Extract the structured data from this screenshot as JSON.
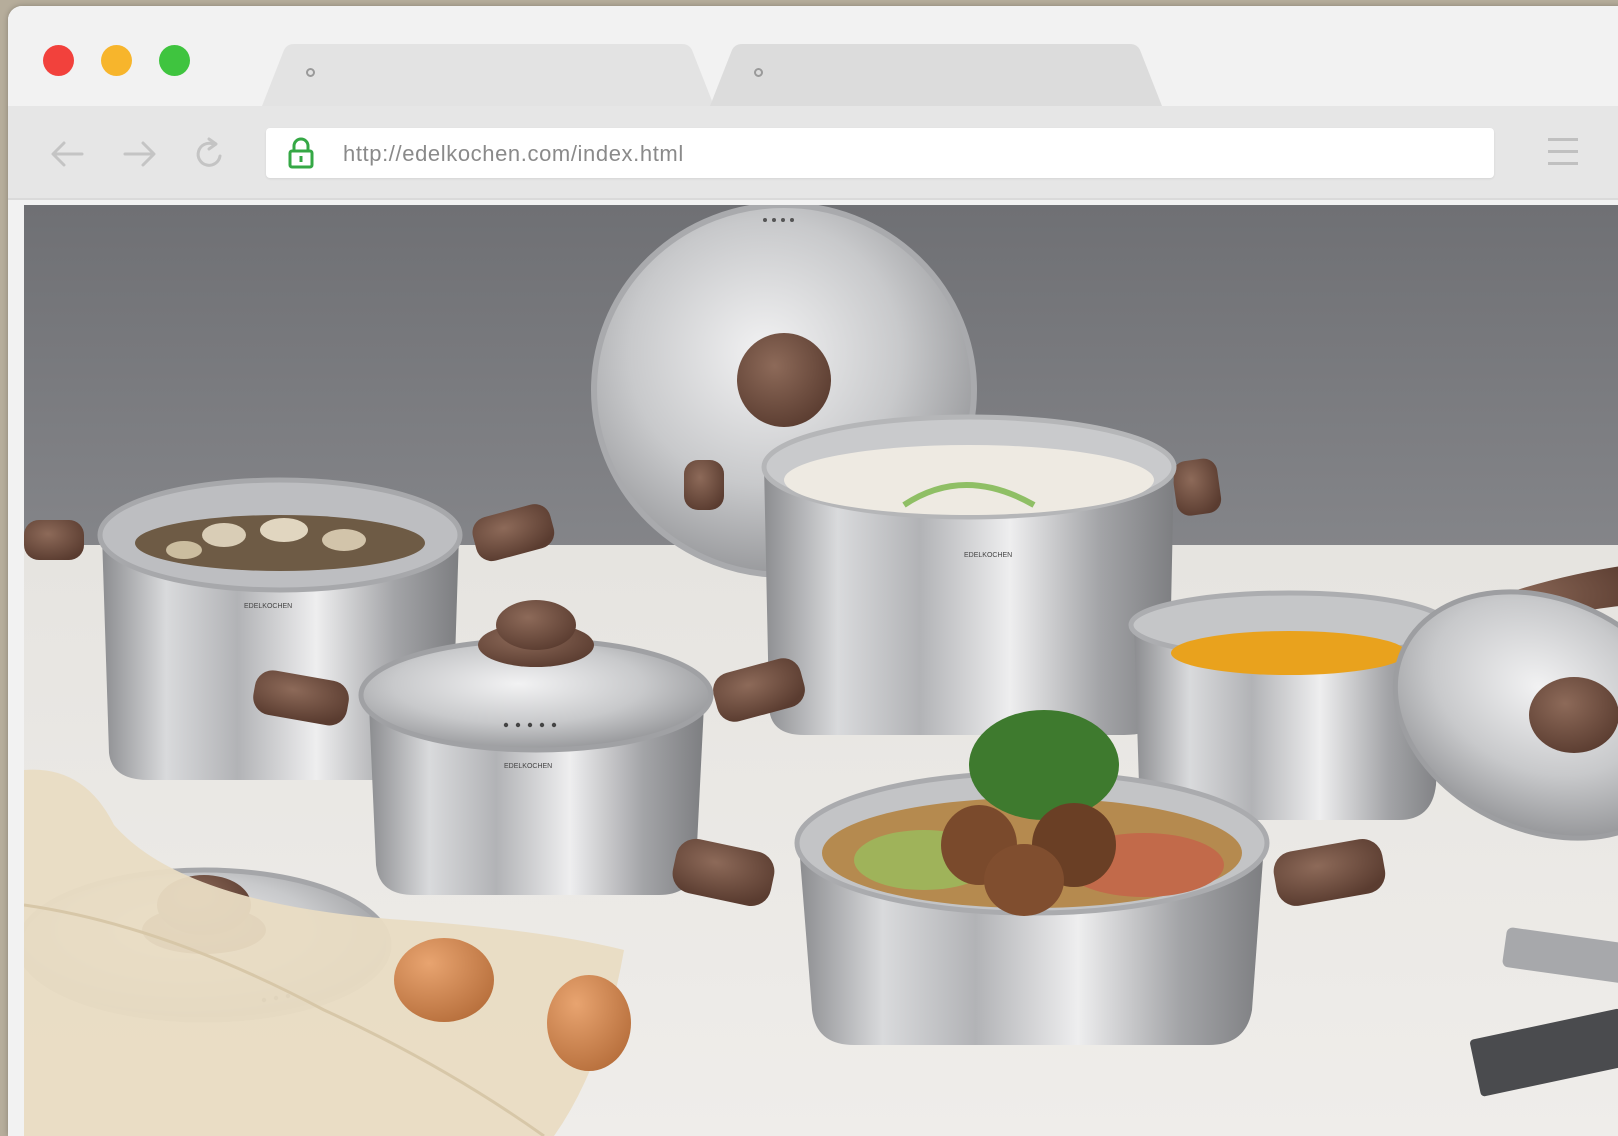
{
  "window": {
    "traffic_lights": [
      "close",
      "minimize",
      "maximize"
    ]
  },
  "tabs": [
    {
      "label": "",
      "icon": "tab-favicon-placeholder-icon"
    },
    {
      "label": "",
      "icon": "tab-favicon-placeholder-icon"
    }
  ],
  "toolbar": {
    "back_icon": "arrow-left-icon",
    "forward_icon": "arrow-right-icon",
    "reload_icon": "reload-icon",
    "menu_icon": "hamburger-menu-icon"
  },
  "address_bar": {
    "url": "http://edelkochen.com/index.html",
    "secure_icon": "lock-icon"
  },
  "content": {
    "pot_brand_mark": "EDELKOCHEN"
  },
  "colors": {
    "close": "#f2413c",
    "minimize": "#f7b52c",
    "maximize": "#3fc43f",
    "lock": "#35a845",
    "handle": "#6b4a3c"
  }
}
